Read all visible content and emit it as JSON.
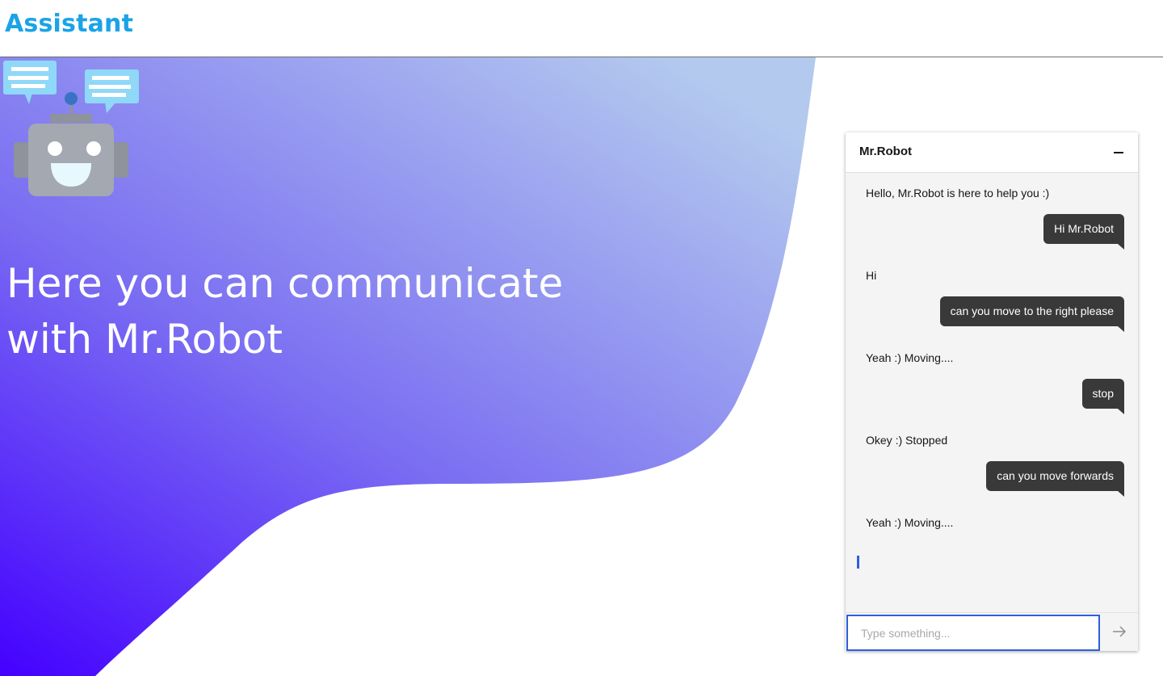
{
  "header": {
    "brand": "Assistant"
  },
  "hero": {
    "line1": "Here you can communicate",
    "line2": "with Mr.Robot"
  },
  "colors": {
    "brand": "#1aa3e8",
    "hero_gradient_start": "#4400ff",
    "hero_gradient_end": "#b3c9ee",
    "user_bubble": "#393939",
    "focus": "#2f5fdb"
  },
  "chat": {
    "title": "Mr.Robot",
    "minimize_icon": "minimize-icon",
    "messages": [
      {
        "from": "bot",
        "text": "Hello, Mr.Robot is here to help you :)"
      },
      {
        "from": "user",
        "text": "Hi Mr.Robot"
      },
      {
        "from": "bot",
        "text": "Hi"
      },
      {
        "from": "user",
        "text": "can you move to the right please"
      },
      {
        "from": "bot",
        "text": "Yeah :) Moving...."
      },
      {
        "from": "user",
        "text": "stop"
      },
      {
        "from": "bot",
        "text": "Okey :) Stopped"
      },
      {
        "from": "user",
        "text": "can you move forwards"
      },
      {
        "from": "bot",
        "text": "Yeah :) Moving...."
      }
    ],
    "input": {
      "placeholder": "Type something...",
      "value": ""
    },
    "send_icon": "arrow-right-icon"
  }
}
